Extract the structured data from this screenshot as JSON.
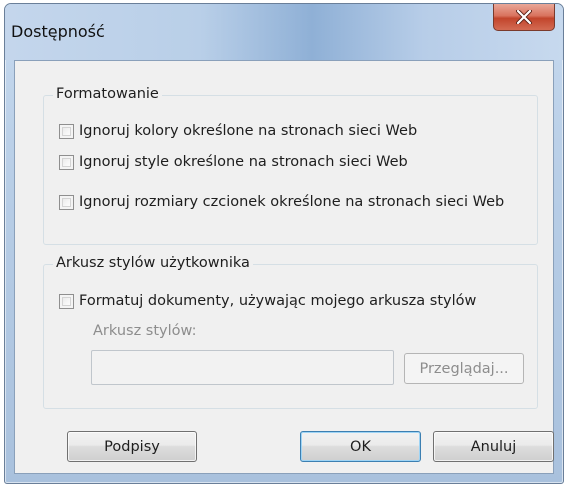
{
  "window": {
    "title": "Dostępność"
  },
  "formatting_group": {
    "title": "Formatowanie",
    "options": [
      {
        "label": "Ignoruj kolory określone na stronach sieci Web",
        "checked": false
      },
      {
        "label": "Ignoruj style określone na stronach sieci Web",
        "checked": false
      },
      {
        "label": "Ignoruj rozmiary czcionek określone na stronach sieci Web",
        "checked": false
      }
    ]
  },
  "user_stylesheet_group": {
    "title": "Arkusz stylów użytkownika",
    "format_option": {
      "label": "Formatuj dokumenty, używając mojego arkusza stylów",
      "checked": false
    },
    "stylesheet_label": "Arkusz stylów:",
    "stylesheet_value": "",
    "browse_label": "Przeglądaj..."
  },
  "buttons": {
    "captions": "Podpisy",
    "ok": "OK",
    "cancel": "Anuluj"
  }
}
